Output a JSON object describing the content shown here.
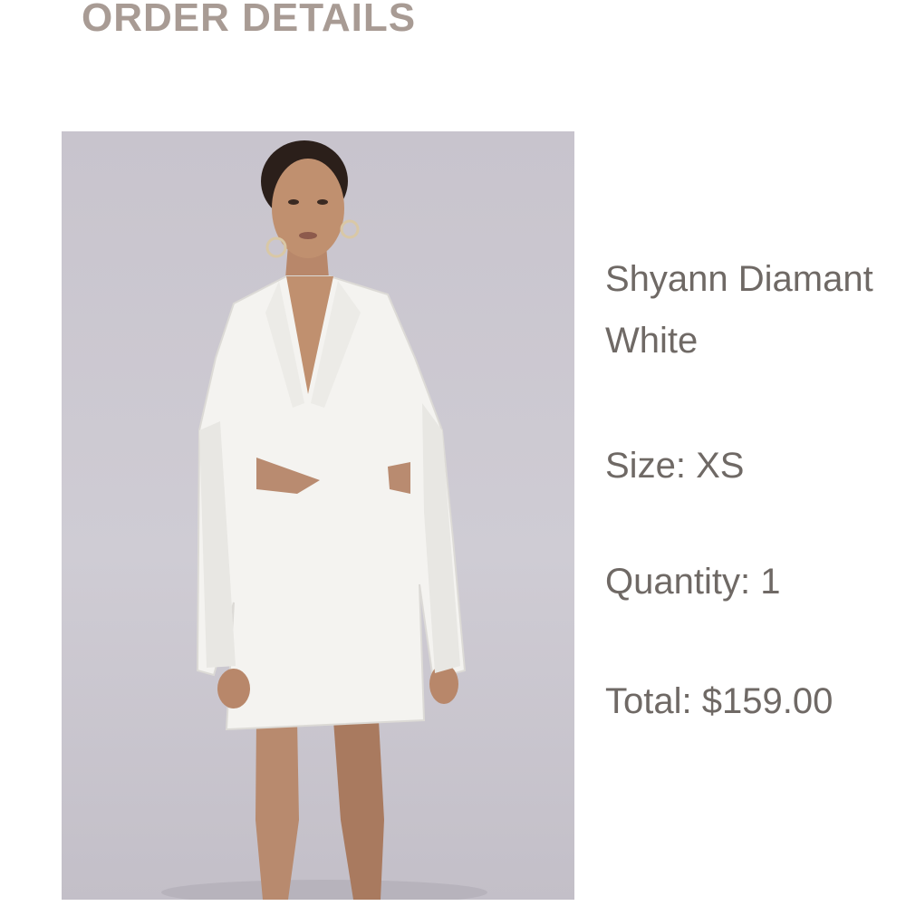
{
  "heading": "ORDER DETAILS",
  "product": {
    "image_icon": "product-photo-white-blazer-dress",
    "name": "Shyann Diamant",
    "color": "White",
    "size_label": "Size:",
    "size_value": "XS",
    "quantity_label": "Quantity:",
    "quantity_value": "1",
    "total_label": "Total:",
    "total_value": "$159.00"
  },
  "colors": {
    "heading": "#a89b94",
    "text": "#6f6965",
    "photo_background": "#cbc7d0",
    "dress": "#f4f3f0"
  }
}
